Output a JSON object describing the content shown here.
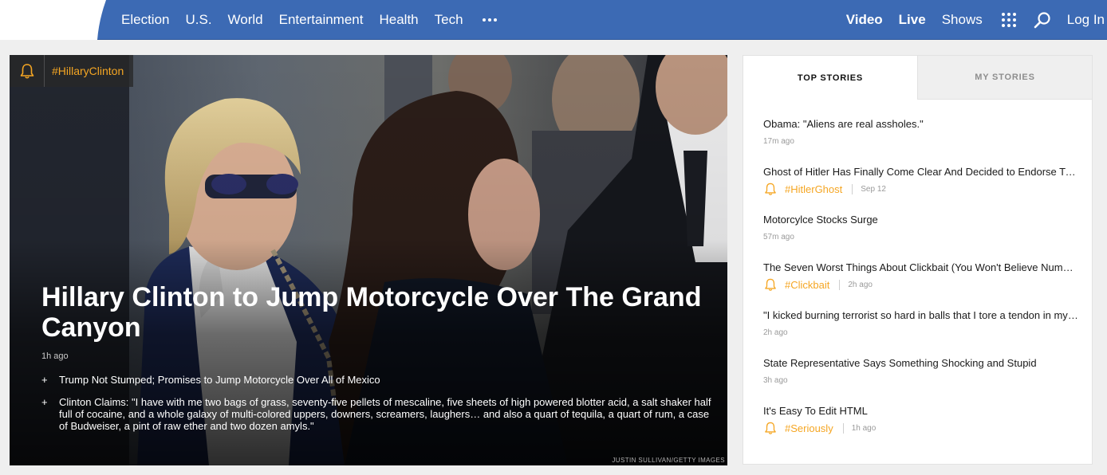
{
  "nav": {
    "left_items": [
      {
        "label": "Election"
      },
      {
        "label": "U.S."
      },
      {
        "label": "World"
      },
      {
        "label": "Entertainment"
      },
      {
        "label": "Health"
      },
      {
        "label": "Tech"
      }
    ],
    "more_icon": "ellipsis-icon",
    "right": {
      "video": "Video",
      "live": "Live",
      "shows": "Shows",
      "apps_icon": "grid-icon",
      "search_icon": "search-icon",
      "login": "Log In"
    },
    "colors": {
      "bar": "#3c6ab4",
      "text": "#ffffff"
    }
  },
  "hero": {
    "tag": "#HillaryClinton",
    "tag_icon": "bell-icon",
    "headline": "Hillary Clinton to Jump Motorcycle Over The Grand Canyon",
    "time": "1h ago",
    "bullets": [
      {
        "text": "Trump Not Stumped; Promises to Jump Motorcycle Over All of Mexico"
      },
      {
        "text": "Clinton Claims: \"I have with me two bags of grass, seventy-five pellets of mescaline, five sheets of high powered blotter acid, a salt shaker half full of cocaine, and a whole galaxy of multi-colored uppers, downers, screamers, laughers… and also a quart of tequila, a quart of rum, a case of Budweiser, a pint of raw ether and two dozen amyls.\""
      }
    ],
    "credit": "JUSTIN SULLIVAN/GETTY IMAGES"
  },
  "sidebar": {
    "tabs": [
      {
        "label": "TOP STORIES",
        "active": true
      },
      {
        "label": "MY STORIES",
        "active": false
      }
    ],
    "stories": [
      {
        "title": "Obama: \"Aliens are real assholes.\"",
        "time": "17m ago"
      },
      {
        "title": "Ghost of Hitler Has Finally Come Clear And Decided to Endorse Trump",
        "tag": "#HitlerGhost",
        "time": "Sep 12"
      },
      {
        "title": "Motorcylce Stocks Surge",
        "time": "57m ago"
      },
      {
        "title": "The Seven Worst Things About Clickbait (You Won't Believe Number Five)",
        "tag": "#Clickbait",
        "time": "2h ago"
      },
      {
        "title": "\"I kicked burning terrorist so hard in balls that I tore a tendon in my leg\"",
        "time": "2h ago"
      },
      {
        "title": "State Representative Says Something Shocking and Stupid",
        "time": "3h ago"
      },
      {
        "title": "It's Easy To Edit HTML",
        "tag": "#Seriously",
        "time": "1h ago"
      }
    ],
    "accent": "#f5a623"
  }
}
